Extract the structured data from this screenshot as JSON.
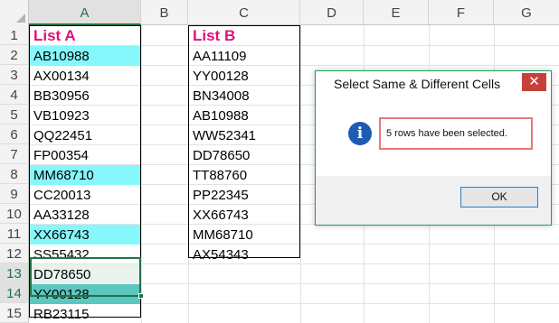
{
  "columns": [
    "A",
    "B",
    "C",
    "D",
    "E",
    "F",
    "G"
  ],
  "rows": [
    "1",
    "2",
    "3",
    "4",
    "5",
    "6",
    "7",
    "8",
    "9",
    "10",
    "11",
    "12",
    "13",
    "14",
    "15"
  ],
  "list_a": {
    "header": "List A",
    "values": [
      "AB10988",
      "AX00134",
      "BB30956",
      "VB10923",
      "QQ22451",
      "FP00354",
      "MM68710",
      "CC20013",
      "AA33128",
      "XX66743",
      "SS55432",
      "DD78650",
      "YY00128",
      "RB23115"
    ]
  },
  "list_b": {
    "header": "List B",
    "values": [
      "AA11109",
      "YY00128",
      "BN34008",
      "AB10988",
      "WW52341",
      "DD78650",
      "TT88760",
      "PP22345",
      "XX66743",
      "MM68710",
      "AX54343"
    ]
  },
  "colors": {
    "highlight": "#86f7fb",
    "header_text": "#e0107a",
    "selection": "#217346",
    "dialog_border": "#1aa15c"
  },
  "dialog": {
    "title": "Select Same & Different Cells",
    "close_glyph": "✕",
    "info_glyph": "i",
    "message": "5 rows have been selected.",
    "ok_label": "OK"
  }
}
